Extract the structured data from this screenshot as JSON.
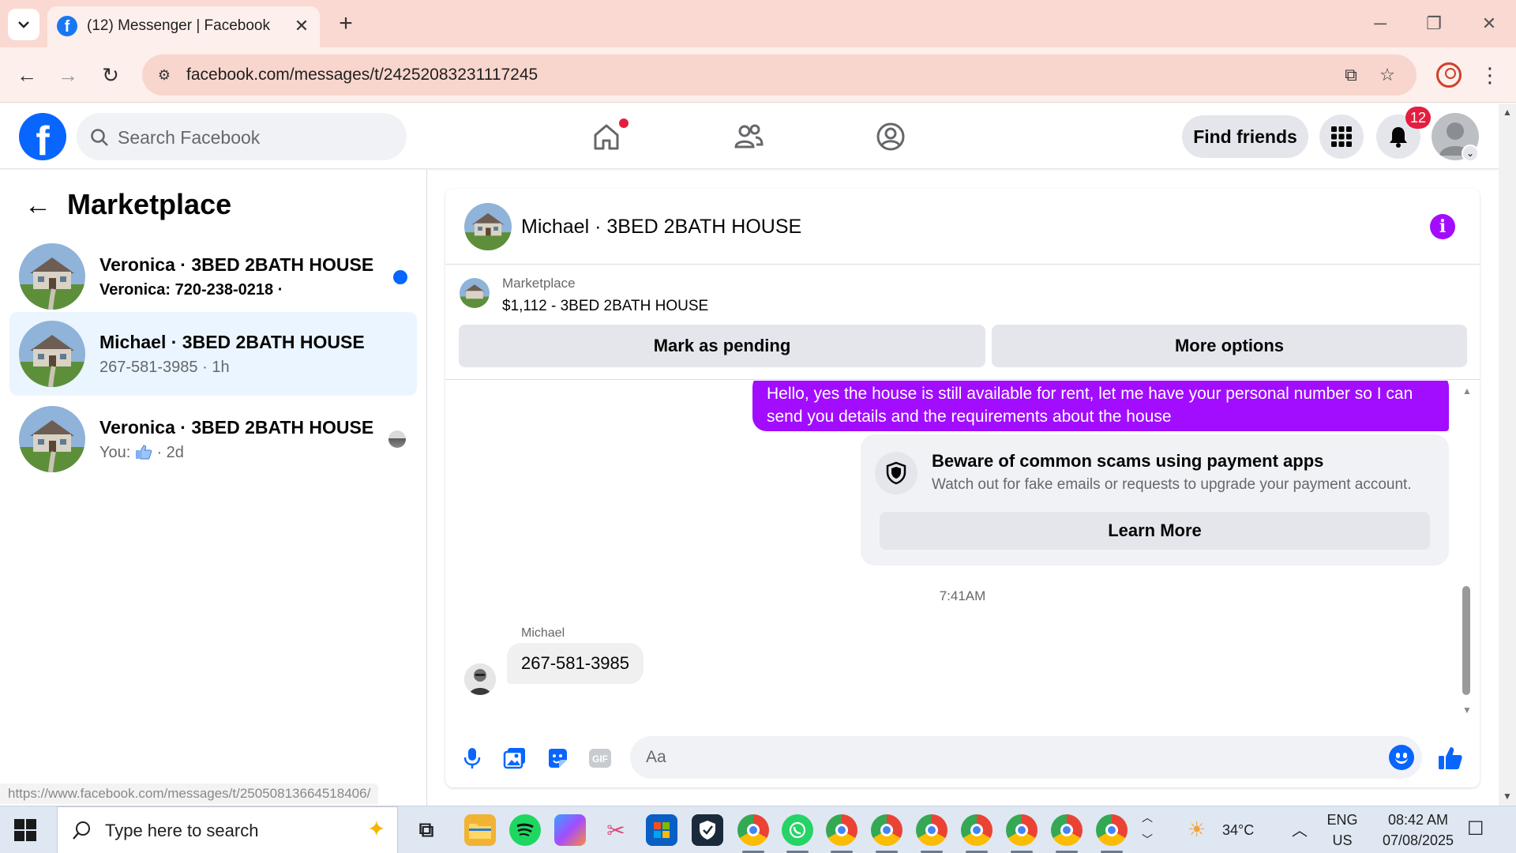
{
  "browser": {
    "tab_title": "(12) Messenger | Facebook",
    "tab_favicon": "f",
    "url": "facebook.com/messages/t/24252083231117245",
    "status_url": "https://www.facebook.com/messages/t/25050813664518406/"
  },
  "fb": {
    "search_placeholder": "Search Facebook",
    "find_friends_label": "Find friends",
    "notification_count": "12",
    "logo": "f"
  },
  "left_panel": {
    "back_glyph": "←",
    "title": "Marketplace",
    "conversations": [
      {
        "name": "Veronica · 3BED 2BATH HOUSE",
        "preview": "Veronica: 720-238-0218 ·",
        "unread": true,
        "active": false
      },
      {
        "name": "Michael · 3BED 2BATH HOUSE",
        "preview": "267-581-3985 · 1h",
        "unread": false,
        "active": true
      },
      {
        "name": "Veronica · 3BED 2BATH HOUSE",
        "preview_prefix": "You:",
        "preview_suffix": " · 2d",
        "unread": false,
        "active": false
      }
    ]
  },
  "chat": {
    "title": "Michael · 3BED 2BATH HOUSE",
    "info_glyph": "i",
    "listing": {
      "label": "Marketplace",
      "price_title": "$1,112 - 3BED 2BATH HOUSE",
      "mark_pending_label": "Mark as pending",
      "more_options_label": "More options"
    },
    "outgoing_message": "Hello, yes the house is still available for rent, let me have your personal number so I can send you details and the requirements about the house",
    "scam_card": {
      "title": "Beware of common scams using payment apps",
      "text": "Watch out for fake emails or requests to upgrade your payment account.",
      "button_label": "Learn More"
    },
    "timestamp": "7:41AM",
    "incoming_sender": "Michael",
    "incoming_message": "267-581-3985",
    "composer_placeholder": "Aa"
  },
  "taskbar": {
    "search_placeholder": "Type here to search",
    "temperature": "34°C",
    "language": "ENG",
    "region": "US",
    "time": "08:42 AM",
    "date": "07/08/2025"
  },
  "colors": {
    "accent_purple": "#a20cff",
    "fb_blue": "#0866ff",
    "active_row": "#ebf5ff",
    "notification_red": "#e41e3f"
  }
}
